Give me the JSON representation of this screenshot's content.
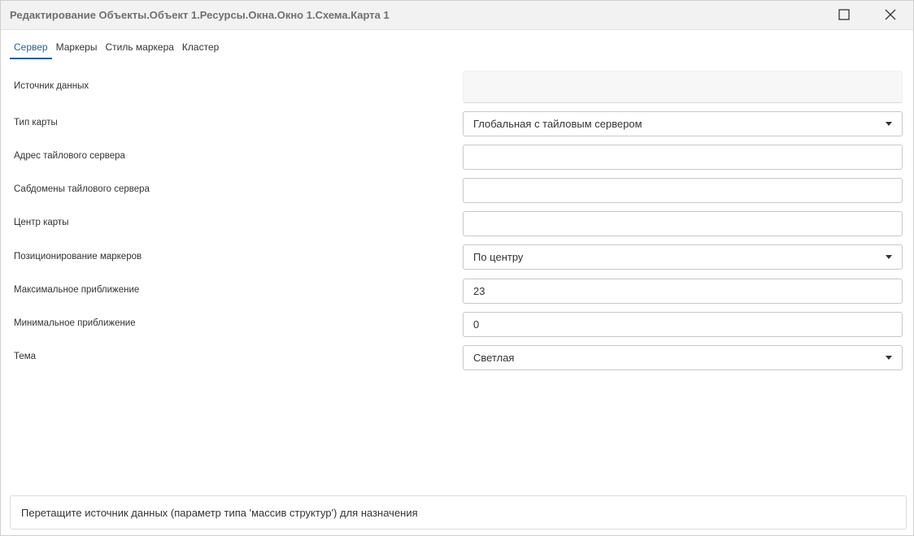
{
  "window": {
    "title": "Редактирование Объекты.Объект 1.Ресурсы.Окна.Окно 1.Схема.Карта 1",
    "maximize_icon": "maximize-icon",
    "close_icon": "close-icon"
  },
  "tabs": [
    {
      "label": "Сервер",
      "active": true
    },
    {
      "label": "Маркеры",
      "active": false
    },
    {
      "label": "Стиль маркера",
      "active": false
    },
    {
      "label": "Кластер",
      "active": false
    }
  ],
  "form": {
    "data_source": {
      "label": "Источник данных",
      "value": ""
    },
    "map_type": {
      "label": "Тип карты",
      "value": "Глобальная с тайловым сервером"
    },
    "tile_server_address": {
      "label": "Адрес тайлового сервера",
      "value": ""
    },
    "tile_server_subdomains": {
      "label": "Сабдомены тайлового сервера",
      "value": ""
    },
    "map_center": {
      "label": "Центр карты",
      "value": ""
    },
    "marker_positioning": {
      "label": "Позиционирование маркеров",
      "value": "По центру"
    },
    "max_zoom": {
      "label": "Максимальное приближение",
      "value": "23"
    },
    "min_zoom": {
      "label": "Минимальное приближение",
      "value": "0"
    },
    "theme": {
      "label": "Тема",
      "value": "Светлая"
    }
  },
  "drop_zone": {
    "text": "Перетащите источник данных (параметр типа 'массив структур') для назначения"
  },
  "colors": {
    "accent": "#1f5f9e",
    "titlebar_bg": "#f2f2f2",
    "title_text": "#707070"
  }
}
